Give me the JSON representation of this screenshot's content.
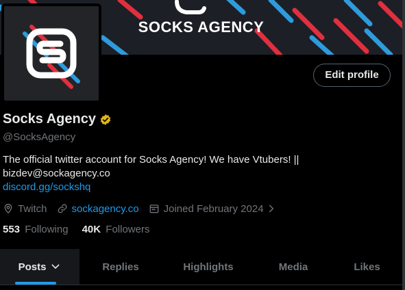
{
  "banner": {
    "title": "SOCKS AGENCY"
  },
  "profile": {
    "edit_label": "Edit profile",
    "display_name": "Socks Agency",
    "handle": "@SocksAgency",
    "bio_line1": "The official twitter account for Socks Agency! We have Vtubers! ||",
    "bio_line2": "bizdev@sockagency.co",
    "bio_link": "discord.gg/sockshq",
    "location": "Twitch",
    "website": "sockagency.co",
    "joined": "Joined February 2024",
    "following_count": "553",
    "following_label": "Following",
    "followers_count": "40K",
    "followers_label": "Followers"
  },
  "tabs": [
    {
      "label": "Posts"
    },
    {
      "label": "Replies"
    },
    {
      "label": "Highlights"
    },
    {
      "label": "Media"
    },
    {
      "label": "Likes"
    }
  ],
  "colors": {
    "accent": "#1d9bf0",
    "verified": "#e2b719",
    "banner_red": "#e0303e",
    "banner_blue": "#2e9bdc"
  },
  "icons": [
    "verified-badge-icon",
    "location-icon",
    "link-icon",
    "calendar-icon",
    "chevron-right-icon",
    "chevron-down-icon"
  ]
}
